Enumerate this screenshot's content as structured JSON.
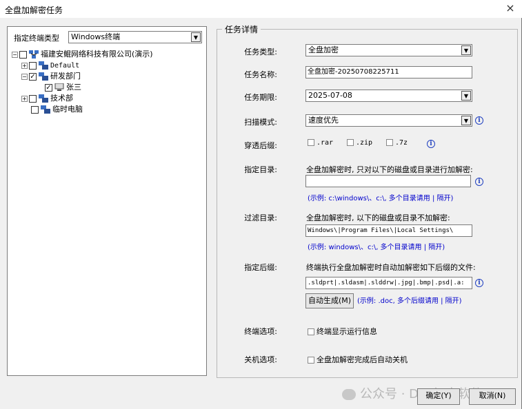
{
  "window": {
    "title": "全盘加解密任务",
    "close": "×"
  },
  "left": {
    "terminal_type_label": "指定终端类型",
    "terminal_type_value": "Windows终端",
    "tree": [
      {
        "label": "福建安鲲网络科技有限公司(演示)",
        "expander": "-",
        "checked": false
      },
      {
        "label": "Default",
        "expander": "+",
        "checked": false
      },
      {
        "label": "研发部门",
        "expander": "-",
        "checked": true
      },
      {
        "label": "张三",
        "expander": "",
        "checked": true
      },
      {
        "label": "技术部",
        "expander": "+",
        "checked": false
      },
      {
        "label": "临时电脑",
        "expander": "",
        "checked": false
      }
    ]
  },
  "details": {
    "group_title": "任务详情",
    "task_type_label": "任务类型:",
    "task_type_value": "全盘加密",
    "task_name_label": "任务名称:",
    "task_name_value": "全盘加密-20250708225711",
    "task_deadline_label": "任务期限:",
    "task_deadline_value": "2025-07-08",
    "scan_mode_label": "扫描模式:",
    "scan_mode_value": "速度优先",
    "archive_label": "穿透后缀:",
    "archive_options": [
      ".rar",
      ".zip",
      ".7z"
    ],
    "dir_label": "指定目录:",
    "dir_desc": "全盘加解密时, 只对以下的磁盘或目录进行加解密:",
    "dir_value": "",
    "dir_hint": "(示例: c:\\windows\\、c:\\, 多个目录请用 | 隔开)",
    "filter_label": "过滤目录:",
    "filter_desc": "全盘加解密时, 以下的磁盘或目录不加解密:",
    "filter_value": "Windows\\|Program Files\\|Local Settings\\",
    "filter_hint": "(示例: windows\\、c:\\, 多个目录请用 | 隔开)",
    "ext_label": "指定后缀:",
    "ext_desc": "终端执行全盘加解密时自动加解密如下后缀的文件:",
    "ext_value": ".sldprt|.sldasm|.slddrw|.jpg|.bmp|.psd|.a:",
    "auto_btn": "自动生成(M)",
    "ext_hint": "(示例: .doc, 多个后缀请用 | 隔开)",
    "term_opt_label": "终端选项:",
    "term_opt_value": "终端显示运行信息",
    "shutdown_label": "关机选项:",
    "shutdown_value": "全盘加解密完成后自动关机"
  },
  "buttons": {
    "ok": "确定(Y)",
    "cancel": "取消(N)"
  },
  "watermark": "公众号 · DLP加密软件"
}
